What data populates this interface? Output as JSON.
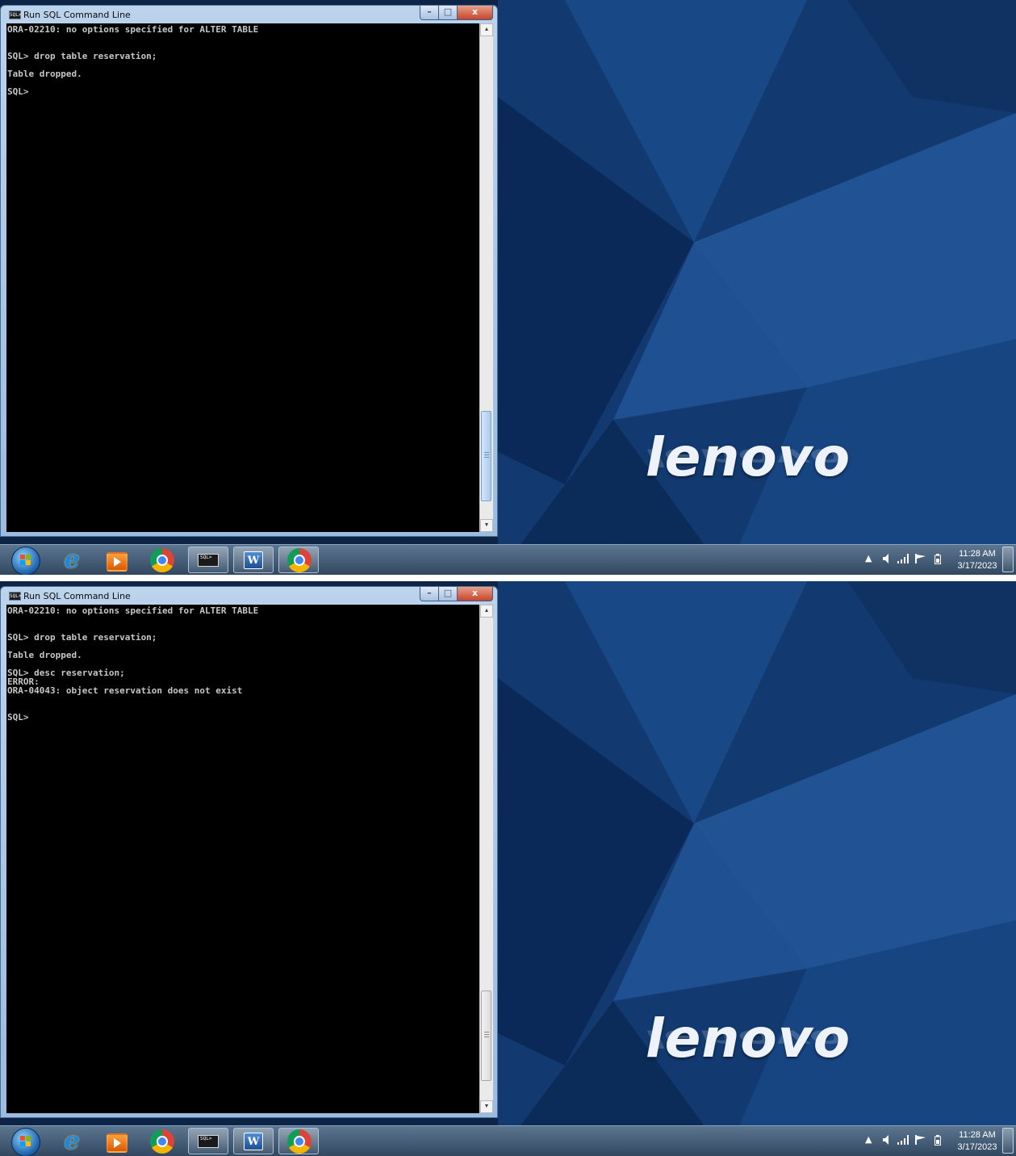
{
  "window": {
    "title": "Run SQL Command Line",
    "app_icon_text": "SQL>"
  },
  "window_controls": {
    "minimize": "–",
    "maximize": "□",
    "close": "x"
  },
  "screens": [
    {
      "console_lines": [
        "ORA-02210: no options specified for ALTER TABLE",
        "",
        "",
        "SQL> drop table reservation;",
        "",
        "Table dropped.",
        "",
        "SQL>"
      ]
    },
    {
      "console_lines": [
        "ORA-02210: no options specified for ALTER TABLE",
        "",
        "",
        "SQL> drop table reservation;",
        "",
        "Table dropped.",
        "",
        "SQL> desc reservation;",
        "ERROR:",
        "ORA-04043: object reservation does not exist",
        "",
        "",
        "SQL>"
      ]
    }
  ],
  "wallpaper": {
    "logo_text": "lenovo"
  },
  "taskbar": {
    "items": [
      "windows-start",
      "internet-explorer",
      "media-player",
      "chrome",
      "sql-command-line",
      "microsoft-word",
      "chrome"
    ],
    "sql_icon_text": "SQL>",
    "word_icon_text": "W"
  },
  "tray": {
    "overflow_arrow": "▲",
    "clock_time": "11:28 AM",
    "clock_date": "3/17/2023"
  },
  "colors": {
    "console_bg": "#000000",
    "console_text": "#c6c6c6",
    "taskbar": "#3f5872",
    "wallpaper": "#123a70"
  }
}
